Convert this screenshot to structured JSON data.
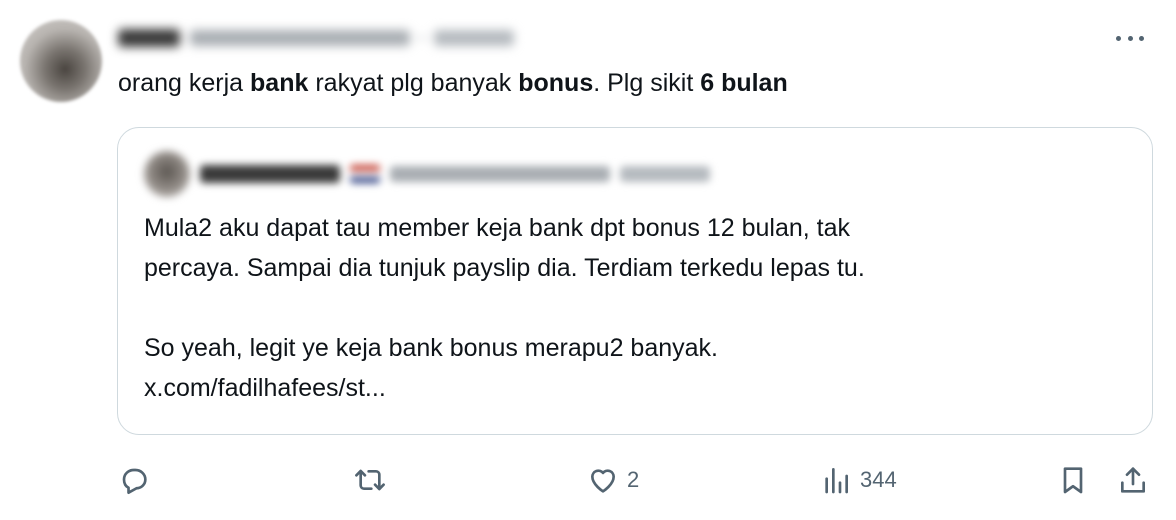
{
  "tweet": {
    "text_parts": [
      {
        "text": "orang kerja ",
        "bold": false
      },
      {
        "text": "bank",
        "bold": true
      },
      {
        "text": " rakyat plg banyak ",
        "bold": false
      },
      {
        "text": "bonus",
        "bold": true
      },
      {
        "text": ". Plg sikit ",
        "bold": false
      },
      {
        "text": "6 bulan",
        "bold": true
      }
    ]
  },
  "quote": {
    "lines": [
      "Mula2 aku dapat tau member keja bank dpt bonus 12 bulan, tak",
      "percaya. Sampai dia tunjuk payslip dia. Terdiam terkedu lepas tu.",
      "",
      "So yeah, legit ye keja bank bonus merapu2 banyak.",
      "x.com/fadilhafees/st..."
    ]
  },
  "actions": {
    "reply": {
      "icon": "reply-icon",
      "count": ""
    },
    "repost": {
      "icon": "repost-icon",
      "count": ""
    },
    "like": {
      "icon": "heart-icon",
      "count": "2"
    },
    "views": {
      "icon": "analytics-icon",
      "count": "344"
    },
    "bookmark": {
      "icon": "bookmark-icon"
    },
    "share": {
      "icon": "share-icon"
    }
  },
  "colors": {
    "text": "#0f1419",
    "muted": "#536471",
    "border": "#cfd9de"
  }
}
